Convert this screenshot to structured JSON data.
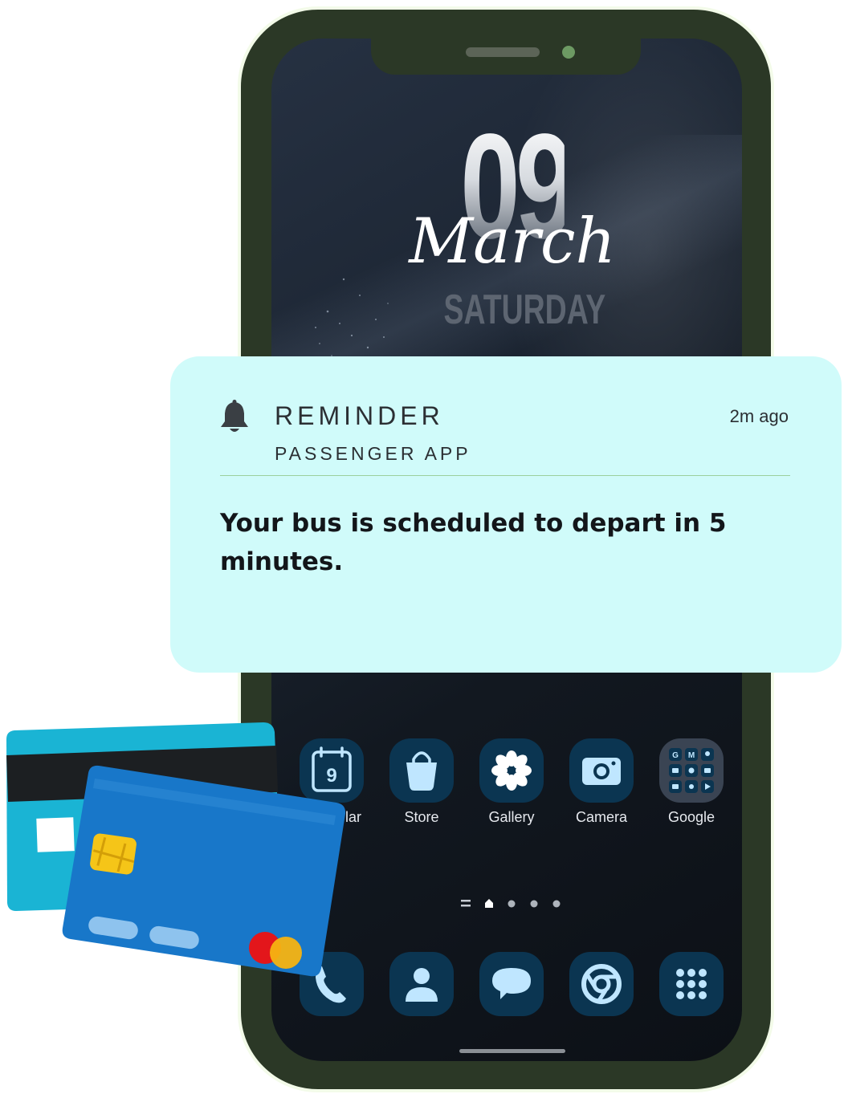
{
  "lockscreen": {
    "day": "09",
    "month": "March",
    "weekday": "SATURDAY"
  },
  "notification": {
    "icon": "bell-icon",
    "title": "REMINDER",
    "app_name": "PASSENGER APP",
    "time": "2m ago",
    "message": "Your bus is scheduled to depart in 5 minutes."
  },
  "home": {
    "apps": [
      {
        "label": "Calendar",
        "visible_label": "lar",
        "icon": "calendar-icon",
        "badge": "9"
      },
      {
        "label": "Store",
        "icon": "shopping-bag-icon"
      },
      {
        "label": "Gallery",
        "icon": "flower-icon"
      },
      {
        "label": "Camera",
        "icon": "camera-icon"
      },
      {
        "label": "Google",
        "icon": "google-folder-icon",
        "folder_letters": [
          "G",
          "M"
        ]
      }
    ],
    "page_indicator": {
      "pages": 4,
      "current": 1
    },
    "dock": [
      {
        "icon": "phone-icon"
      },
      {
        "icon": "contacts-icon"
      },
      {
        "icon": "messages-icon"
      },
      {
        "icon": "chrome-icon"
      },
      {
        "icon": "app-drawer-icon"
      }
    ]
  },
  "colors": {
    "phone_frame": "#2b3826",
    "notification_bg": "#d0fbfa",
    "app_icon_bg": "#0b3551",
    "app_icon_fg": "#bfe6ff",
    "card_back": "#1ab4d4",
    "card_front": "#1877c9",
    "chip": "#f5c518"
  }
}
